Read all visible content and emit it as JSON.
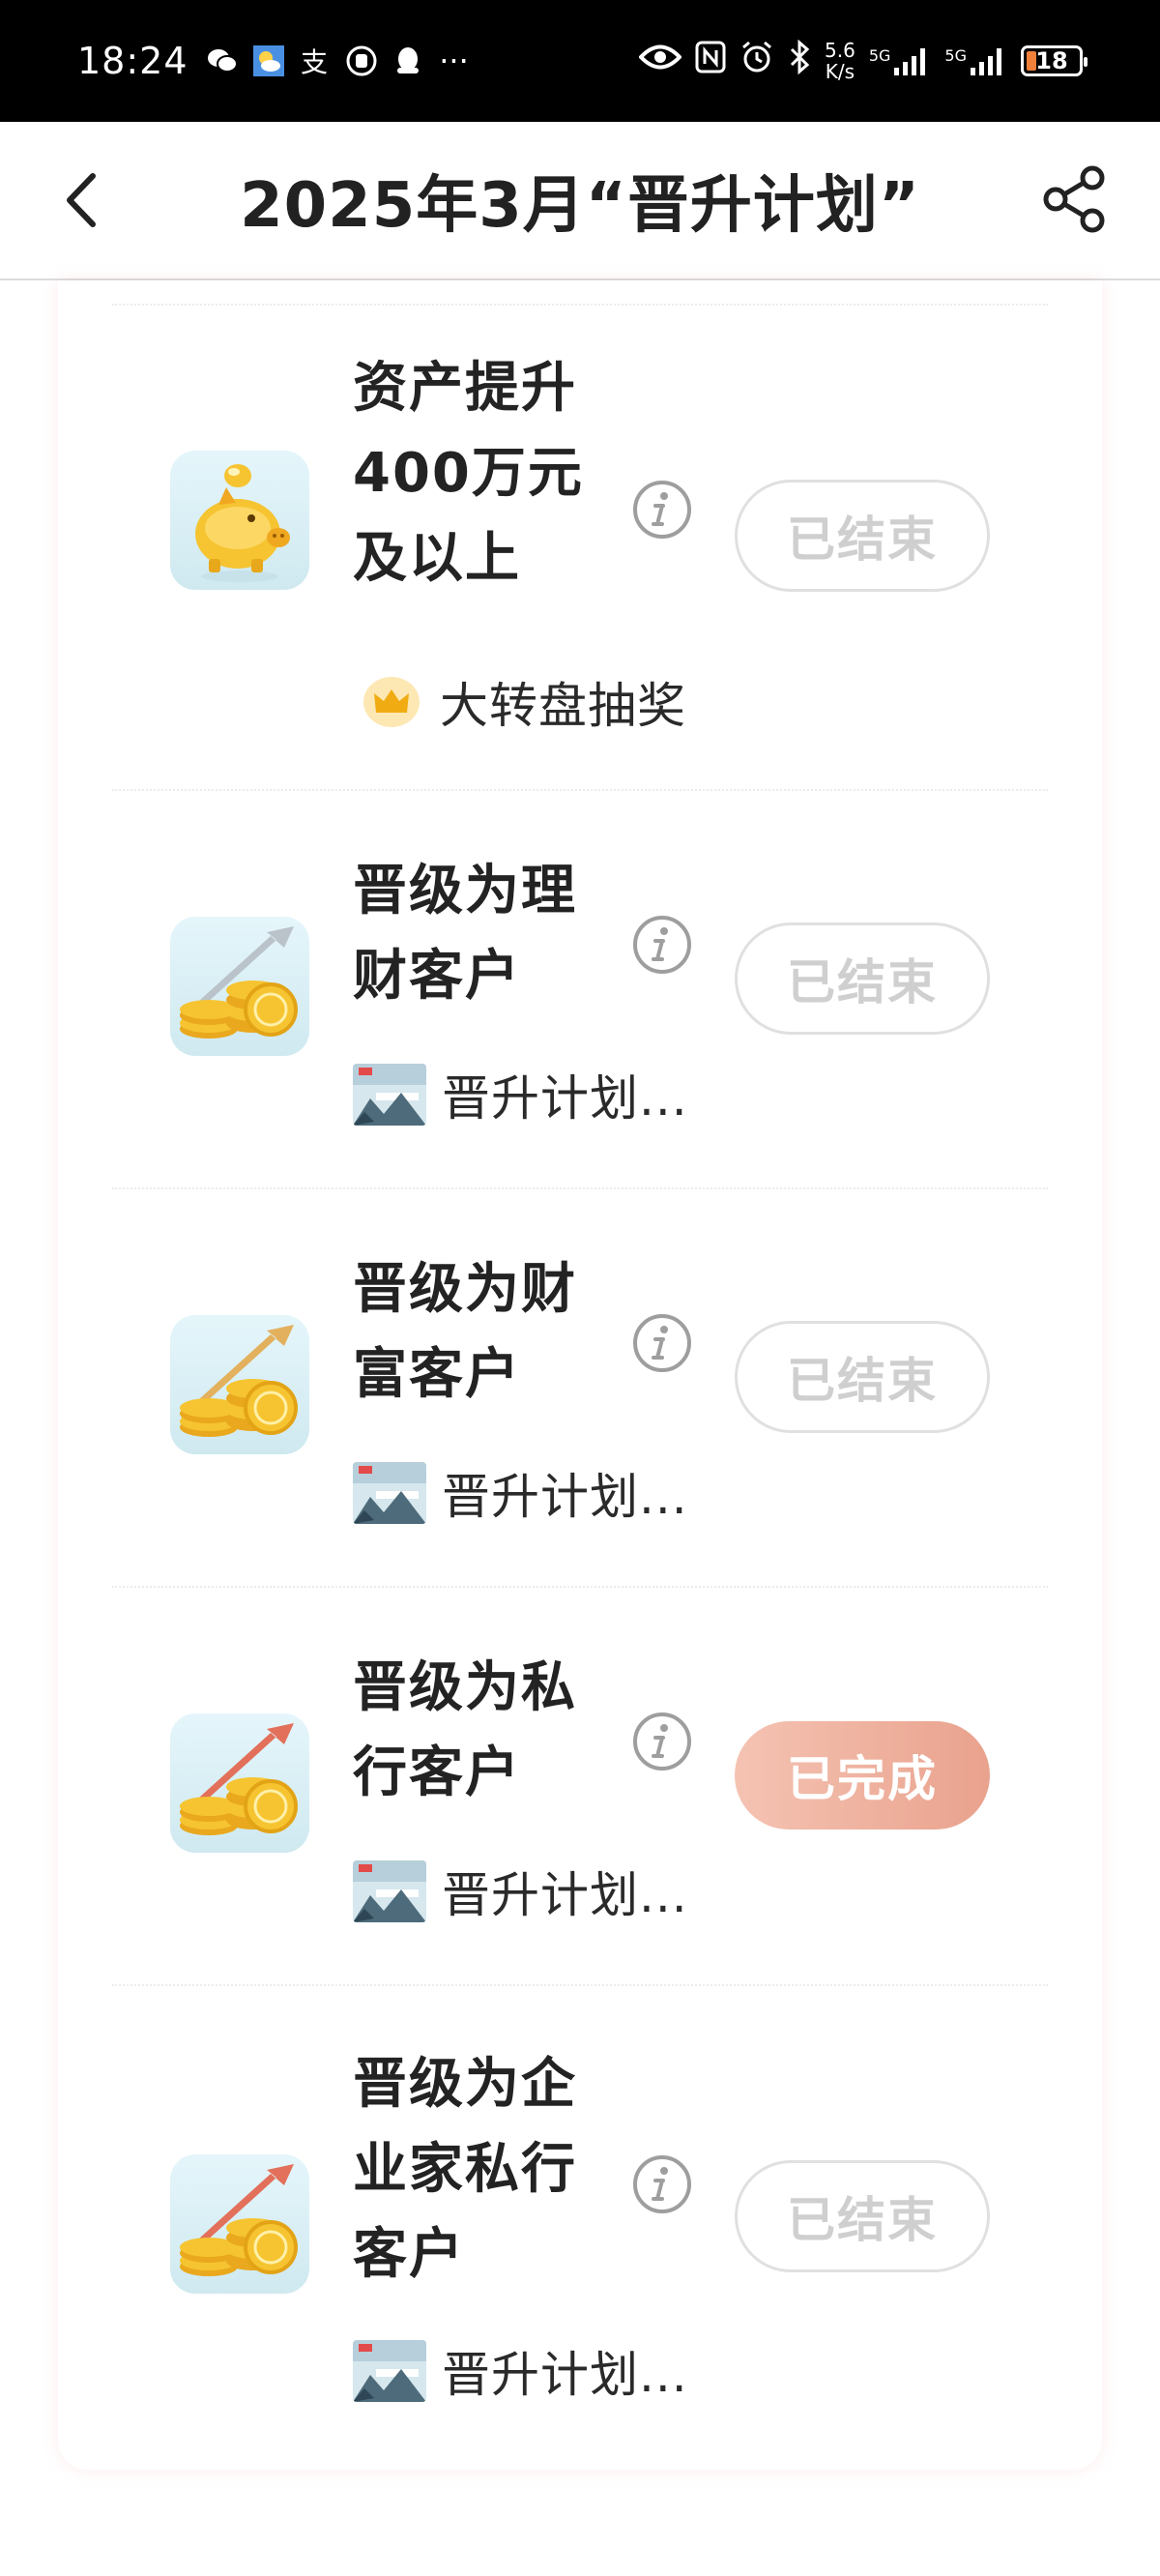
{
  "status_bar": {
    "time": "18:24",
    "left_icons": [
      "wechat-icon",
      "weather-icon",
      "alipay-icon",
      "hand-icon",
      "qq-icon",
      "more-icon"
    ],
    "more": "···",
    "net_speed_value": "5.6",
    "net_speed_unit": "K/s",
    "signal_1": "5G",
    "signal_2": "5G",
    "battery": "18"
  },
  "header": {
    "title": "2025年3月“晋升计划”"
  },
  "tasks": [
    {
      "title": "资产提升400万元及以上",
      "title_lines": [
        "资产提升",
        "400万元",
        "及以上"
      ],
      "icon": "piggy-bank-icon",
      "status": "已结束",
      "reward": "大转盘抽奖",
      "reward_icon": "crown-icon"
    },
    {
      "title": "晋级为理财客户",
      "title_lines": [
        "晋级为理",
        "财客户"
      ],
      "icon": "coins-arrow-icon",
      "status": "已结束",
      "reward": "晋升计划...",
      "reward_icon": "reward-thumbnail"
    },
    {
      "title": "晋级为财富客户",
      "title_lines": [
        "晋级为财",
        "富客户"
      ],
      "icon": "coins-arrow-icon",
      "status": "已结束",
      "reward": "晋升计划...",
      "reward_icon": "reward-thumbnail"
    },
    {
      "title": "晋级为私行客户",
      "title_lines": [
        "晋级为私",
        "行客户"
      ],
      "icon": "coins-arrow-icon",
      "status": "已完成",
      "reward": "晋升计划...",
      "reward_icon": "reward-thumbnail"
    },
    {
      "title": "晋级为企业家私行客户",
      "title_lines": [
        "晋级为企",
        "业家私行",
        "客户"
      ],
      "icon": "coins-arrow-icon",
      "status": "已结束",
      "reward": "晋升计划...",
      "reward_icon": "reward-thumbnail"
    }
  ],
  "colors": {
    "done_button": "#eba792",
    "ended_button_text": "#cfcfcf",
    "icon_bg": "#dff2f7",
    "coin_gold": "#f5c431"
  }
}
